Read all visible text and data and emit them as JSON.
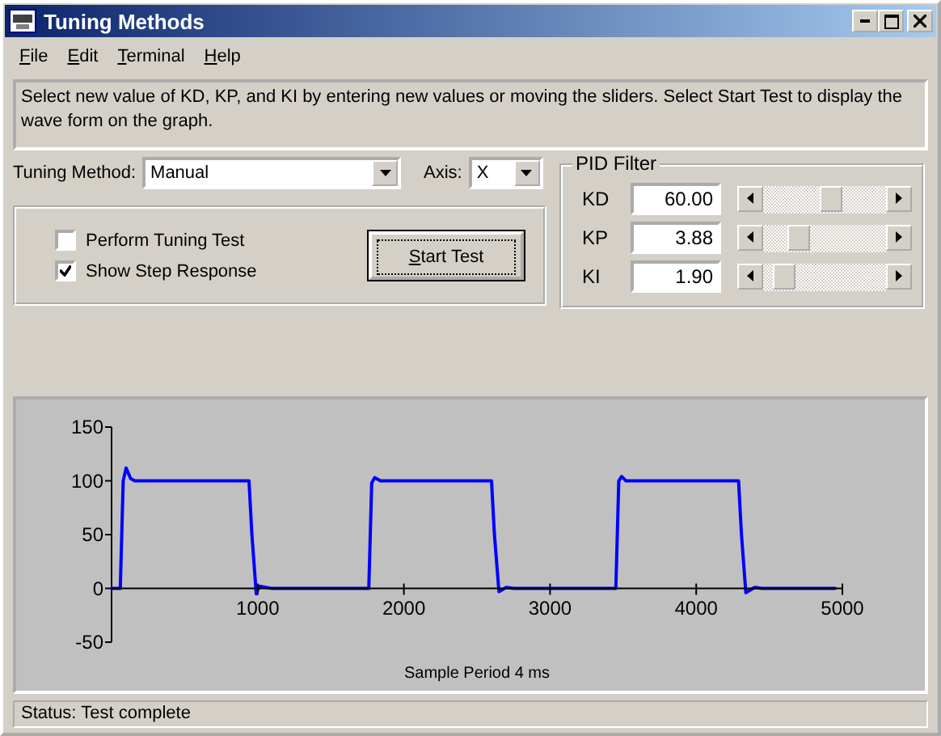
{
  "window": {
    "title": "Tuning Methods"
  },
  "menu": [
    "File",
    "Edit",
    "Terminal",
    "Help"
  ],
  "instructions": "Select new value of KD, KP, and KI by entering new values or moving the sliders.  Select Start Test to display the wave form on the graph.",
  "tuning_method": {
    "label": "Tuning Method:",
    "value": "Manual"
  },
  "axis": {
    "label": "Axis:",
    "value": "X"
  },
  "options": [
    {
      "label": "Perform Tuning Test",
      "checked": false
    },
    {
      "label": "Show Step Response",
      "checked": true
    }
  ],
  "start_button": "Start Test",
  "pid_filter": {
    "title": "PID Filter",
    "params": [
      {
        "name": "KD",
        "value": "60.00",
        "level": 0.57
      },
      {
        "name": "KP",
        "value": "3.88",
        "level": 0.24
      },
      {
        "name": "KI",
        "value": "1.90",
        "level": 0.1
      }
    ]
  },
  "graph": {
    "chart_data": {
      "type": "line",
      "xlabel": "Sample Period 4 ms",
      "xlim": [
        0,
        5000
      ],
      "ylim": [
        -50,
        150
      ],
      "xticks": [
        1000,
        2000,
        3000,
        4000,
        5000
      ],
      "yticks": [
        -50,
        0,
        50,
        100,
        150
      ],
      "x": [
        0,
        60,
        80,
        100,
        130,
        160,
        940,
        960,
        990,
        1010,
        1100,
        1760,
        1780,
        1800,
        1840,
        2600,
        2620,
        2650,
        2700,
        2750,
        3450,
        3470,
        3490,
        3520,
        4290,
        4310,
        4340,
        4400,
        4450,
        4950
      ],
      "series": [
        {
          "color": "#0000ff",
          "values": [
            0,
            0,
            100,
            112,
            102,
            100,
            100,
            50,
            -5,
            2,
            0,
            0,
            98,
            103,
            100,
            100,
            50,
            -3,
            1,
            0,
            0,
            100,
            104,
            100,
            100,
            50,
            -4,
            1,
            0,
            0
          ]
        }
      ]
    }
  },
  "status_bar": "Status: Test complete"
}
